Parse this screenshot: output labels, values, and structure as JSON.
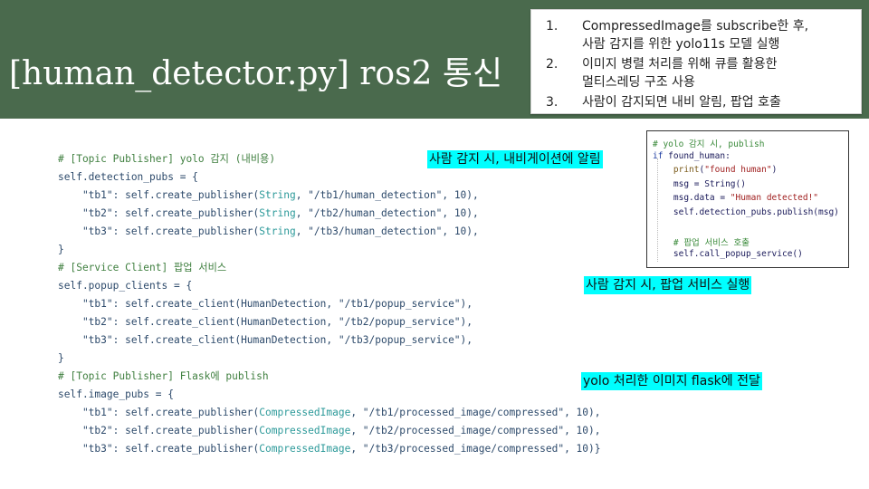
{
  "slide": {
    "title": "[human_detector.py] ros2 통신",
    "notes": [
      {
        "num": "1.",
        "lines": [
          "CompressedImage를 subscribe한 후,",
          "사람 감지를 위한 yolo11s 모델 실행"
        ]
      },
      {
        "num": "2.",
        "lines": [
          "이미지 병렬 처리를 위해 큐를 활용한",
          "멀티스레딩 구조 사용"
        ]
      },
      {
        "num": "3.",
        "lines": [
          "사람이 감지되면 내비 알림, 팝업 호출"
        ]
      }
    ]
  },
  "code": {
    "lines": [
      [
        {
          "t": "# [Topic Publisher] yolo 감지 (내비용)",
          "c": "c-comment"
        }
      ],
      [
        {
          "t": "self.detection_pubs = {",
          "c": "c-plain"
        }
      ],
      [
        {
          "t": "    \"tb1\": self.create_publisher(",
          "c": "c-plain"
        },
        {
          "t": "String",
          "c": "c-cls"
        },
        {
          "t": ", \"/tb1/human_detection\", 10),",
          "c": "c-plain"
        }
      ],
      [
        {
          "t": "    \"tb2\": self.create_publisher(",
          "c": "c-plain"
        },
        {
          "t": "String",
          "c": "c-cls"
        },
        {
          "t": ", \"/tb2/human_detection\", 10),",
          "c": "c-plain"
        }
      ],
      [
        {
          "t": "    \"tb3\": self.create_publisher(",
          "c": "c-plain"
        },
        {
          "t": "String",
          "c": "c-cls"
        },
        {
          "t": ", \"/tb3/human_detection\", 10),",
          "c": "c-plain"
        }
      ],
      [
        {
          "t": "}",
          "c": "c-plain"
        }
      ],
      [
        {
          "t": "# [Service Client] 팝업 서비스",
          "c": "c-comment"
        }
      ],
      [
        {
          "t": "self.popup_clients = {",
          "c": "c-plain"
        }
      ],
      [
        {
          "t": "    \"tb1\": self.create_client(HumanDetection, \"/tb1/popup_service\"),",
          "c": "c-plain"
        }
      ],
      [
        {
          "t": "    \"tb2\": self.create_client(HumanDetection, \"/tb2/popup_service\"),",
          "c": "c-plain"
        }
      ],
      [
        {
          "t": "    \"tb3\": self.create_client(HumanDetection, \"/tb3/popup_service\"),",
          "c": "c-plain"
        }
      ],
      [
        {
          "t": "}",
          "c": "c-plain"
        }
      ],
      [
        {
          "t": "# [Topic Publisher] Flask에 publish",
          "c": "c-comment"
        }
      ],
      [
        {
          "t": "self.image_pubs = {",
          "c": "c-plain"
        }
      ],
      [
        {
          "t": "    \"tb1\": self.create_publisher(",
          "c": "c-plain"
        },
        {
          "t": "CompressedImage",
          "c": "c-cls"
        },
        {
          "t": ", \"/tb1/processed_image/compressed\", 10),",
          "c": "c-plain"
        }
      ],
      [
        {
          "t": "    \"tb2\": self.create_publisher(",
          "c": "c-plain"
        },
        {
          "t": "CompressedImage",
          "c": "c-cls"
        },
        {
          "t": ", \"/tb2/processed_image/compressed\", 10),",
          "c": "c-plain"
        }
      ],
      [
        {
          "t": "    \"tb3\": self.create_publisher(",
          "c": "c-plain"
        },
        {
          "t": "CompressedImage",
          "c": "c-cls"
        },
        {
          "t": ", \"/tb3/processed_image/compressed\", 10)}",
          "c": "c-plain"
        }
      ]
    ]
  },
  "highlights": {
    "navigation": "사람 감지 시, 내비게이션에 알림",
    "popup": "사람 감지 시, 팝업 서비스 실행",
    "flask": "yolo 처리한 이미지 flask에 전달"
  },
  "snippet": {
    "lines": [
      [
        {
          "t": "# yolo 감지 시, publish",
          "c": "s-com"
        }
      ],
      [
        {
          "t": "if ",
          "c": "s-kw"
        },
        {
          "t": "found_human:",
          "c": "s-pl"
        }
      ],
      [
        {
          "t": "    ",
          "c": "s-pl"
        },
        {
          "t": "print",
          "c": "s-fn"
        },
        {
          "t": "(",
          "c": "s-pl"
        },
        {
          "t": "\"found human\"",
          "c": "s-str"
        },
        {
          "t": ")",
          "c": "s-pl"
        }
      ],
      [
        {
          "t": "    msg = String()",
          "c": "s-pl"
        }
      ],
      [
        {
          "t": "    msg.data = ",
          "c": "s-pl"
        },
        {
          "t": "\"Human detected!\"",
          "c": "s-str"
        }
      ],
      [
        {
          "t": "    self.detection_pubs.publish(msg)",
          "c": "s-pl"
        }
      ],
      [
        {
          "t": "",
          "c": "s-pl"
        }
      ],
      [
        {
          "t": "    # 팝업 서비스 호출",
          "c": "s-com"
        }
      ],
      [
        {
          "t": "    self.call_popup_service()",
          "c": "s-pl"
        }
      ]
    ]
  },
  "colors": {
    "banner": "#4a6a4d",
    "highlight": "#00ffff"
  }
}
